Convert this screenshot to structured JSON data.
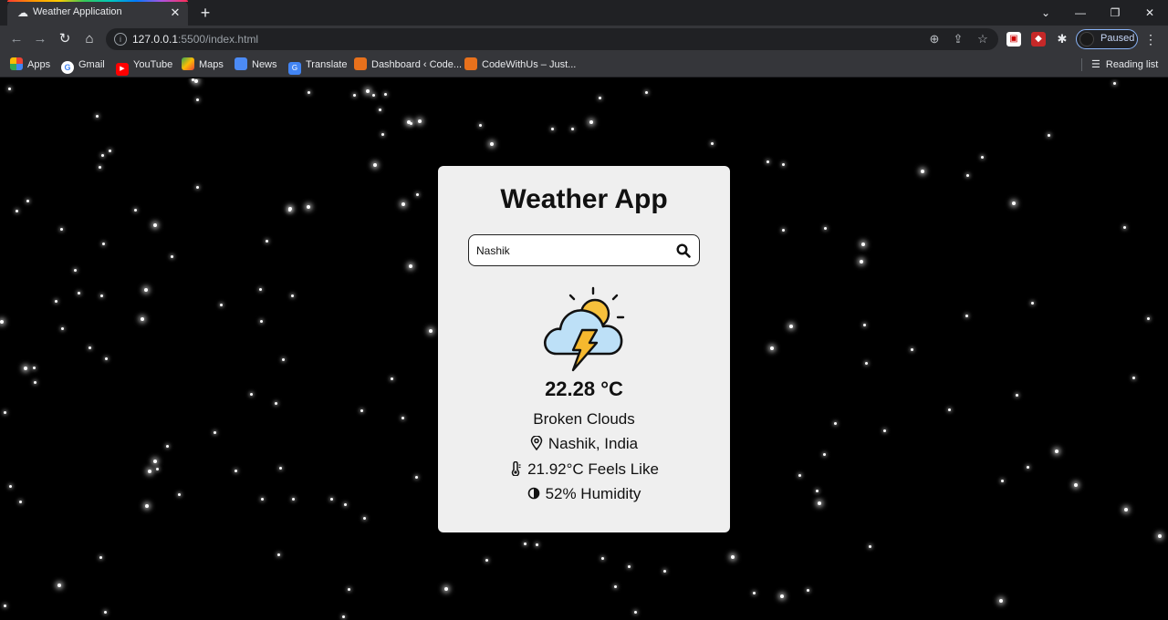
{
  "browser": {
    "tab_title": "Weather Application",
    "url_host": "127.0.0.1",
    "url_rest": ":5500/index.html",
    "profile_status": "Paused",
    "bookmarks": [
      "Apps",
      "Gmail",
      "YouTube",
      "Maps",
      "News",
      "Translate",
      "Dashboard ‹ Code...",
      "CodeWithUs – Just..."
    ],
    "reading_list": "Reading list"
  },
  "app": {
    "title": "Weather App",
    "search_value": "Nashik",
    "temperature": "22.28 °C",
    "description": "Broken Clouds",
    "location": "Nashik, India",
    "feels_like": "21.92°C Feels Like",
    "humidity": "52% Humidity",
    "icon": "thunderstorm-cloud-sun-icon"
  },
  "colors": {
    "page_bg": "#000000",
    "card_bg": "#efefef",
    "cloud": "#bde0f7",
    "sun": "#f7c13c",
    "bolt": "#f5b82e"
  }
}
